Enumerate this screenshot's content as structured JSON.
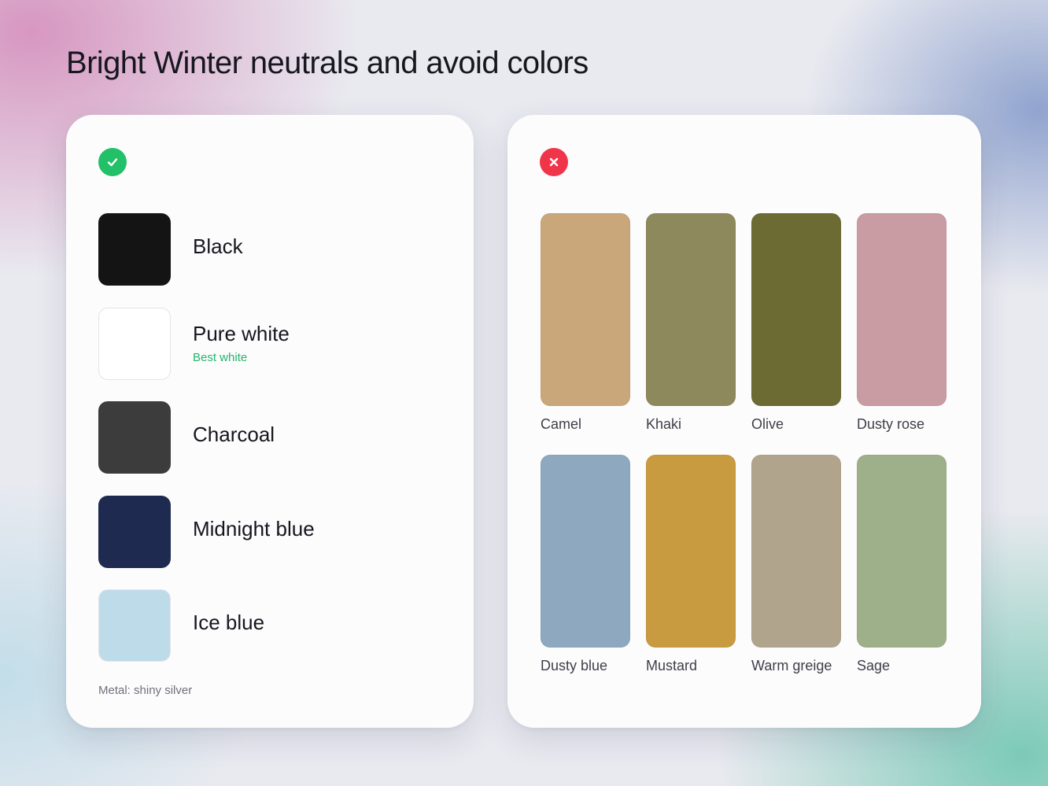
{
  "title": "Bright Winter neutrals and avoid colors",
  "neutrals": {
    "status_icon": "check-icon",
    "items": [
      {
        "name": "Black",
        "color": "#141414"
      },
      {
        "name": "Pure white",
        "color": "#ffffff",
        "note": "Best white"
      },
      {
        "name": "Charcoal",
        "color": "#3c3c3c"
      },
      {
        "name": "Midnight blue",
        "color": "#1e2a4f"
      },
      {
        "name": "Ice blue",
        "color": "#bedbea"
      }
    ],
    "footer": "Metal: shiny silver"
  },
  "avoid": {
    "status_icon": "close-icon",
    "items": [
      {
        "name": "Camel",
        "color": "#c9a77b"
      },
      {
        "name": "Khaki",
        "color": "#8e885d"
      },
      {
        "name": "Olive",
        "color": "#6b6b33"
      },
      {
        "name": "Dusty rose",
        "color": "#c99ba2"
      },
      {
        "name": "Dusty blue",
        "color": "#8da8bf"
      },
      {
        "name": "Mustard",
        "color": "#c89b40"
      },
      {
        "name": "Warm greige",
        "color": "#b0a48d"
      },
      {
        "name": "Sage",
        "color": "#9db08a"
      }
    ]
  }
}
